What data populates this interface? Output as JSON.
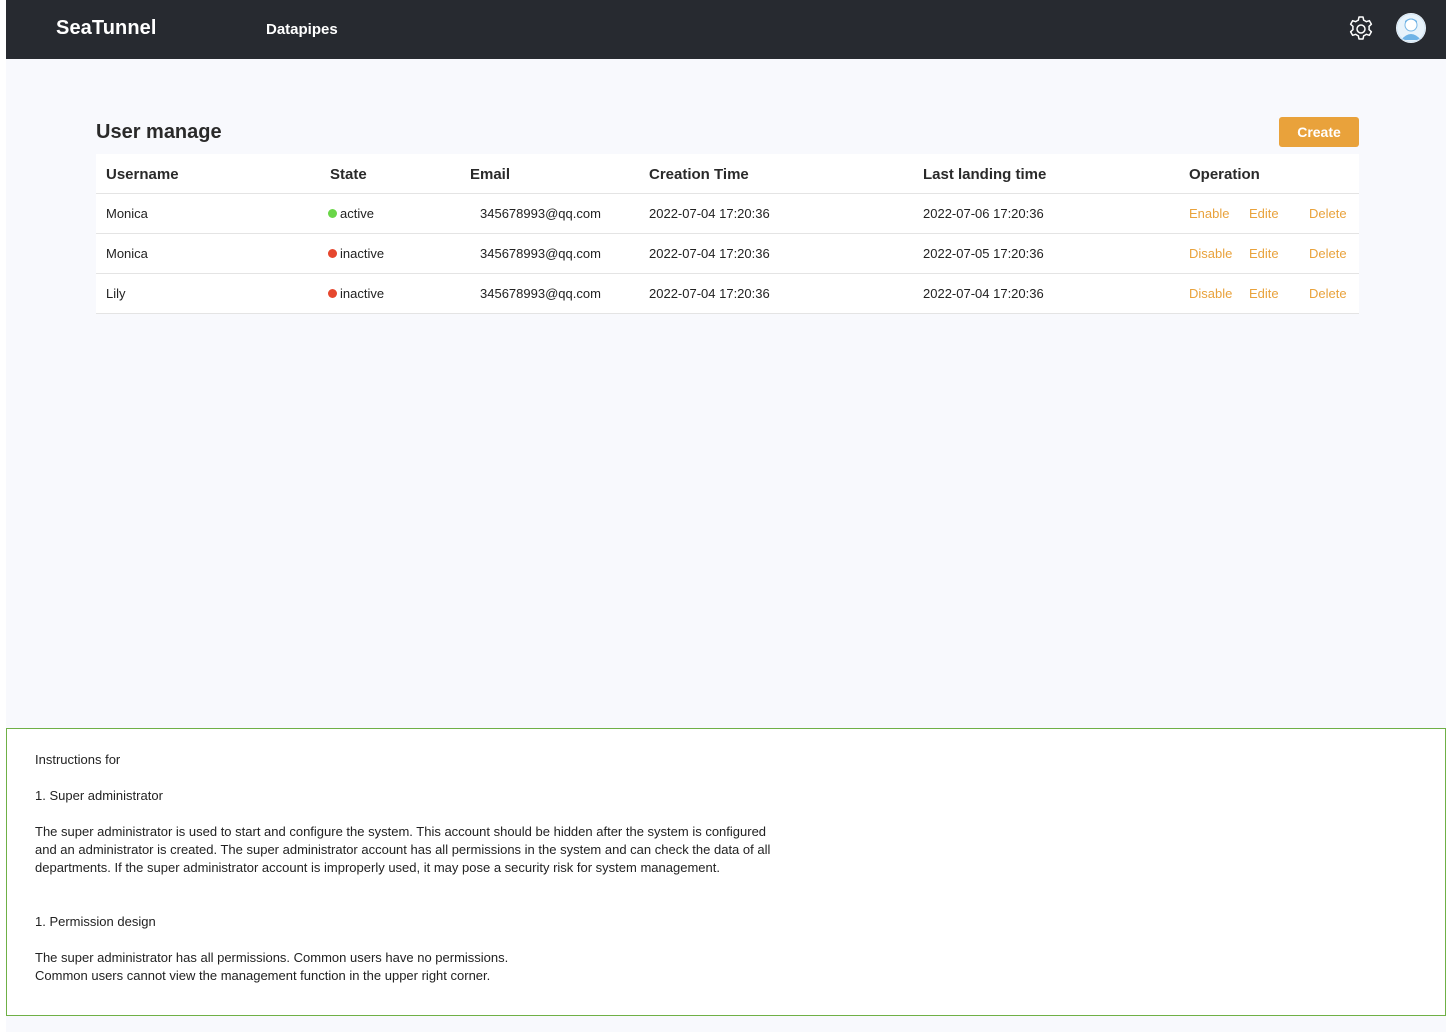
{
  "app": {
    "brand": "SeaTunnel",
    "nav_items": [
      "Datapipes"
    ],
    "icons": {
      "settings": "gear-icon",
      "user": "avatar-icon"
    }
  },
  "page": {
    "title": "User manage",
    "create_label": "Create"
  },
  "table": {
    "headers": [
      "Username",
      "State",
      "Email",
      "Creation Time",
      "Last landing time",
      "Operation"
    ],
    "rows": [
      {
        "username": "Monica",
        "state": "active",
        "state_color": "#6ad648",
        "email": "345678993@qq.com",
        "creation_time": "2022-07-04 17:20:36",
        "last_landing_time": "2022-07-06 17:20:36",
        "ops": [
          "Enable",
          "Edite",
          "Delete"
        ]
      },
      {
        "username": "Monica",
        "state": "inactive",
        "state_color": "#e6472e",
        "email": "345678993@qq.com",
        "creation_time": "2022-07-04 17:20:36",
        "last_landing_time": "2022-07-05 17:20:36",
        "ops": [
          "Disable",
          "Edite",
          "Delete"
        ]
      },
      {
        "username": "Lily",
        "state": "inactive",
        "state_color": "#e6472e",
        "email": "345678993@qq.com",
        "creation_time": "2022-07-04 17:20:36",
        "last_landing_time": "2022-07-04 17:20:36",
        "ops": [
          "Disable",
          "Edite",
          "Delete"
        ]
      }
    ]
  },
  "instructions": {
    "heading": "Instructions for",
    "section1_title": "1. Super administrator",
    "section1_body": "The super administrator is used to start and configure the system. This account should be hidden after the system is configured and an administrator is created. The super administrator account has all permissions in the system and can check the data of all departments. If the super administrator account is improperly used, it may pose a security risk for system management.",
    "section2_title": "1. Permission design",
    "section2_line1": "The super administrator has all permissions. Common users have no permissions.",
    "section2_line2": "Common users cannot view the management function in the upper right corner."
  },
  "colors": {
    "accent": "#e9a23b",
    "topbar": "#272a30",
    "active": "#6ad648",
    "inactive": "#e6472e",
    "instructions_border": "#6fb046"
  }
}
